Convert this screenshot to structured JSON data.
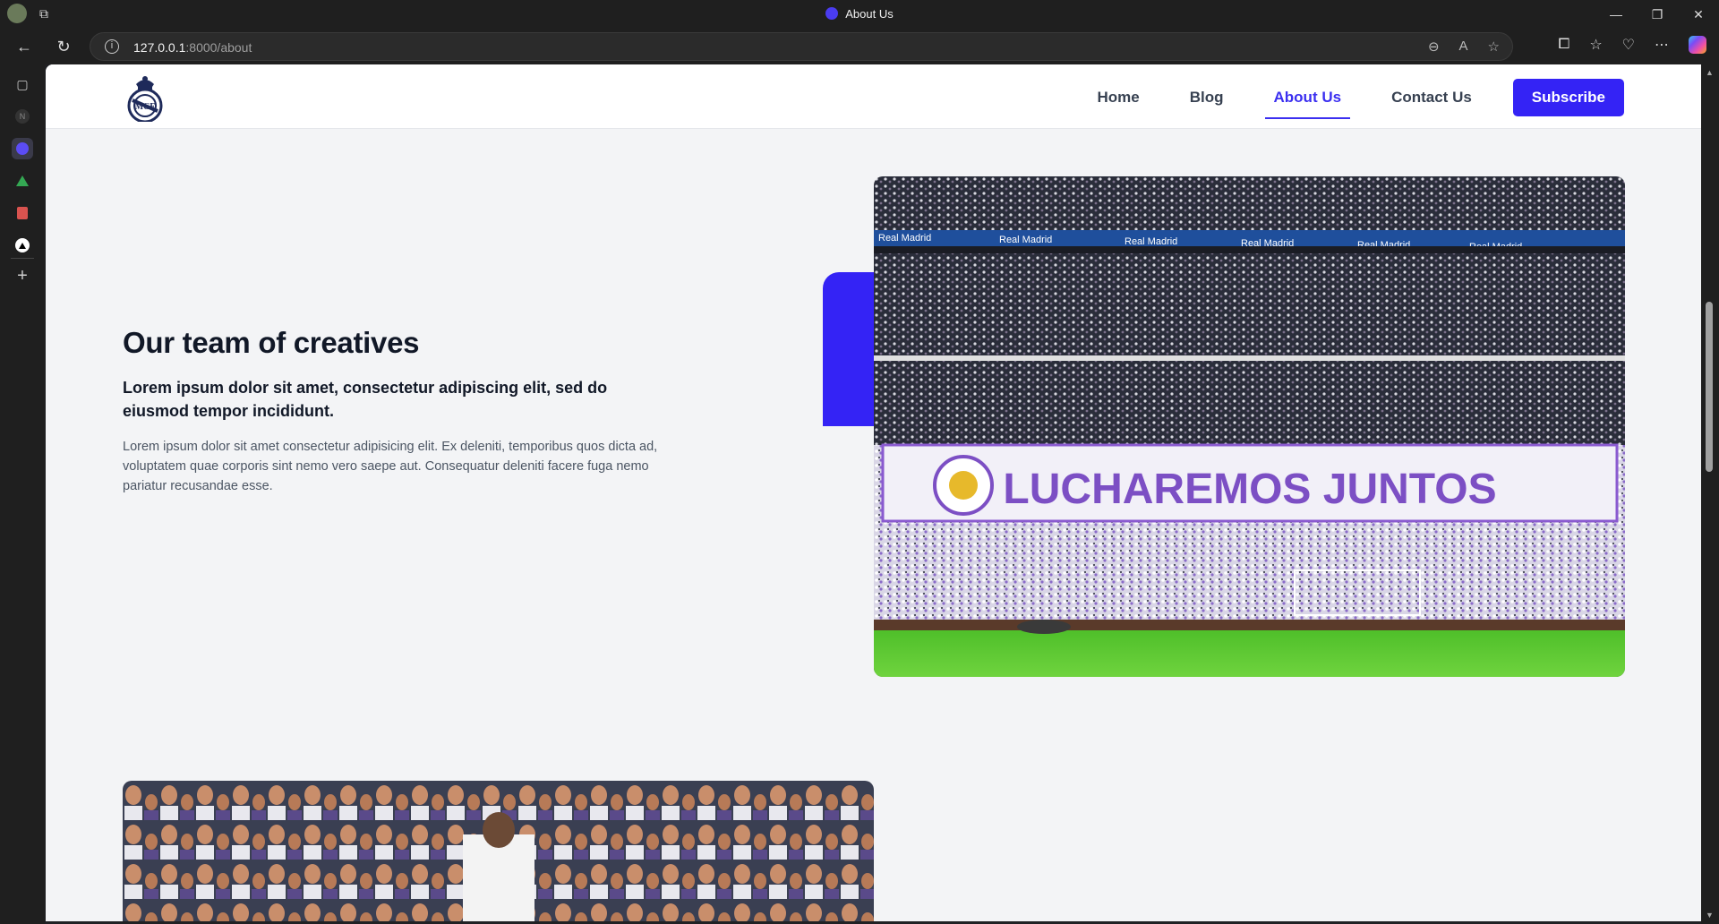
{
  "browser": {
    "tab_title": "About Us",
    "url_host": "127.0.0.1",
    "url_path": ":8000/about",
    "window_controls": [
      "—",
      "❐",
      "✕"
    ]
  },
  "site": {
    "nav": {
      "home": "Home",
      "blog": "Blog",
      "about": "About Us",
      "contact": "Contact Us",
      "subscribe": "Subscribe",
      "active": "about"
    },
    "colors": {
      "accent": "#3423f5",
      "background": "#f3f4f6"
    }
  },
  "hero": {
    "title": "Our team of creatives",
    "subtitle": "Lorem ipsum dolor sit amet, consectetur adipiscing elit, sed do eiusmod tempor incididunt.",
    "body": "Lorem ipsum dolor sit amet consectetur adipisicing elit. Ex deleniti, temporibus quos dicta ad, voluptatem quae corporis sint nemo vero saepe aut. Consequatur deleniti facere fuga nemo pariatur recusandae esse."
  },
  "images": {
    "stadium_banner": "LUCHAREMOS JUNTOS",
    "stadium_boards": "Real Madrid"
  }
}
